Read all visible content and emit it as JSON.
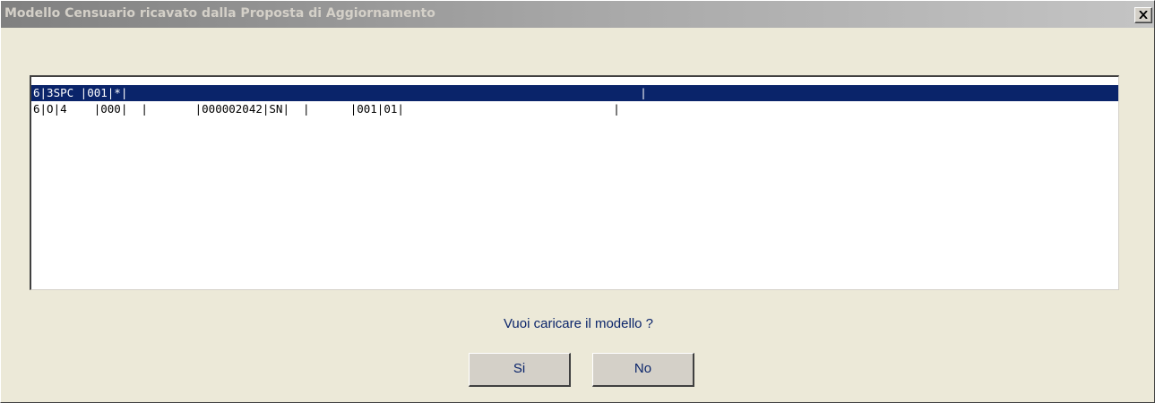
{
  "window": {
    "title": "Modello Censuario ricavato dalla Proposta di Aggiornamento",
    "close_label": "×"
  },
  "list": {
    "rows": [
      {
        "text": "6|3SPC |001|*|                                                                            |",
        "selected": true
      },
      {
        "text": "6|O|4    |000|  |       |000002042|SN|  |      |001|01|                               |",
        "selected": false
      }
    ]
  },
  "prompt": "Vuoi caricare il modello ?",
  "buttons": {
    "yes_label": "Si",
    "no_label": "No"
  },
  "colors": {
    "selection_bg": "#0a246a",
    "dialog_bg": "#ece9d8",
    "text_accent": "#0a246a"
  }
}
